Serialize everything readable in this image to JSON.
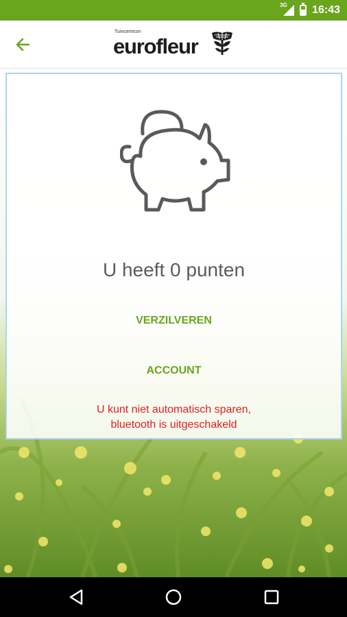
{
  "status_bar": {
    "network": "3G",
    "time": "16:43"
  },
  "header": {
    "logo_small_text": "Tuincentrum",
    "logo_brand": "eurofleur",
    "back_icon": "arrow-left-icon",
    "accent_color": "#6aa51e"
  },
  "main": {
    "points_text": "U heeft 0 punten",
    "redeem_label": "VERZILVEREN",
    "account_label": "ACCOUNT",
    "warning_line1": "U kunt niet automatisch sparen,",
    "warning_line2": "bluetooth is uitgeschakeld",
    "warning_color": "#e02020",
    "illustration_icon": "piggy-bank-icon"
  },
  "nav_bar": {
    "icons": [
      "back-triangle-icon",
      "home-circle-icon",
      "recents-square-icon"
    ]
  }
}
